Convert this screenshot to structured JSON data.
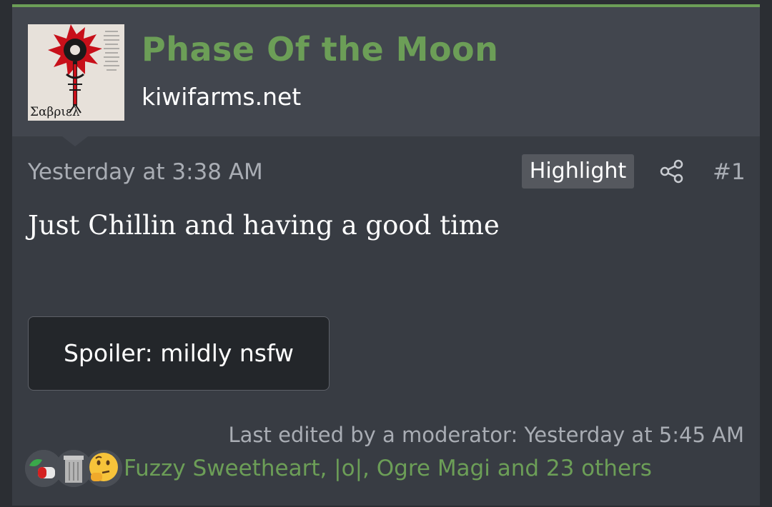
{
  "user": {
    "name": "Phase Of the Moon",
    "title": "kiwifarms.net",
    "avatar_icon": "avatar-sigil-image",
    "avatar_caption": "Σαβριελ"
  },
  "post": {
    "date": "Yesterday at 3:38 AM",
    "highlight_label": "Highlight",
    "share_icon": "share-icon",
    "number": "#1",
    "body": "Just Chillin and having a good time",
    "spoiler_label": "Spoiler: mildly nsfw",
    "last_edited": "Last edited by a moderator: Yesterday at 5:45 AM"
  },
  "reactions": {
    "icons": [
      "leaf-pill-reaction-icon",
      "trash-can-reaction-icon",
      "thinking-face-reaction-icon"
    ],
    "users_text": "Fuzzy Sweetheart, |o|, Ogre Magi and 23 others"
  },
  "colors": {
    "accent_green": "#6c9e57",
    "post_bg": "#383c43",
    "header_bg": "#42464e",
    "page_bg": "#2b2e33"
  }
}
